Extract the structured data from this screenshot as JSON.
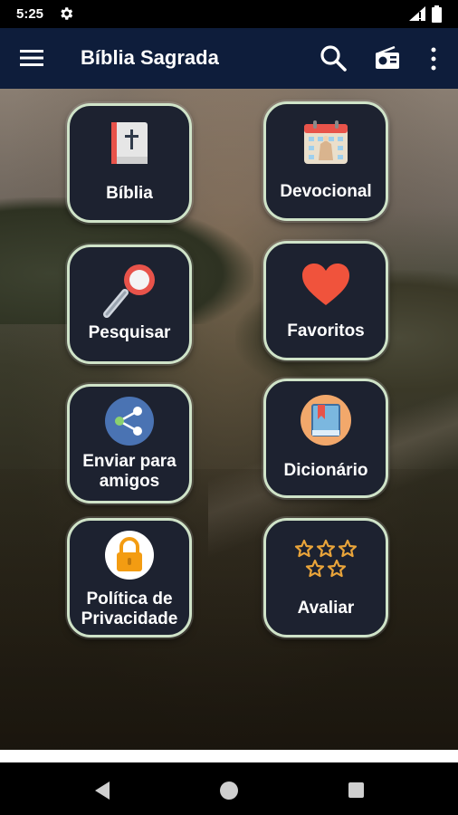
{
  "status_bar": {
    "time": "5:25"
  },
  "app_bar": {
    "title": "Bíblia Sagrada"
  },
  "tiles": [
    {
      "label": "Bíblia",
      "icon": "bible-book-icon"
    },
    {
      "label": "Devocional",
      "icon": "calendar-icon"
    },
    {
      "label": "Pesquisar",
      "icon": "magnifier-icon"
    },
    {
      "label": "Favoritos",
      "icon": "heart-icon"
    },
    {
      "label_line1": "Enviar para",
      "label_line2": "amigos",
      "icon": "share-icon"
    },
    {
      "label": "Dicionário",
      "icon": "bookmark-book-icon"
    },
    {
      "label_line1": "Política de",
      "label_line2": "Privacidade",
      "icon": "lock-icon"
    },
    {
      "label": "Avaliar",
      "icon": "stars-icon"
    }
  ],
  "colors": {
    "app_bar": "#0e1d3b",
    "tile_bg": "#1d2230",
    "tile_border": "#cfe3c8",
    "heart": "#f0533c",
    "star": "#e9a43a"
  }
}
